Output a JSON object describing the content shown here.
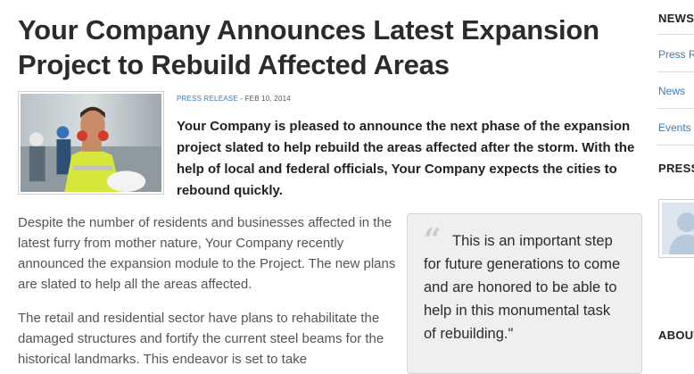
{
  "article": {
    "title": "Your Company Announces Latest Expansion Project to Rebuild Affected Areas",
    "category": "PRESS RELEASE",
    "date_separator": " - ",
    "date": "FEB 10, 2014",
    "lede": "Your Company is pleased to announce the next phase of the expansion project slated to help rebuild the areas affected after the storm. With the help of local and federal officials, Your Company expects the cities to rebound quickly.",
    "paragraphs": [
      "Despite the number of residents and businesses affected in the latest furry from mother nature, Your Company recently announced the expansion module to the Project. The new plans are slated to help all the areas affected.",
      "The retail and residential sector have plans to rehabilitate the damaged structures and fortify the current steel beams for the historical landmarks. This endeavor is set to take"
    ],
    "pull_quote": "This is an important step for future generations to come and are honored to be able to help in this monumental task of rebuilding.\""
  },
  "sidebar": {
    "heading_1": "NEWS",
    "links": [
      "Press Releases",
      "News",
      "Events"
    ],
    "heading_2": "PRESS",
    "heading_3": "ABOUT"
  },
  "icons": {
    "quote": "quote-mark-icon"
  },
  "colors": {
    "link": "#3a78b8",
    "title": "#2b2b2b",
    "quote_bg": "#efefef"
  }
}
